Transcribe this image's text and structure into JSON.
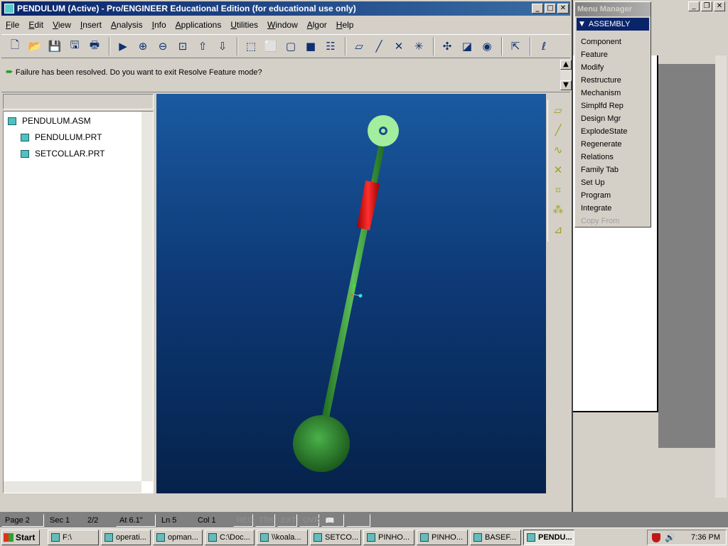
{
  "window": {
    "title": "PENDULUM (Active) - Pro/ENGINEER Educational Edition (for educational use only)"
  },
  "menubar": [
    "File",
    "Edit",
    "View",
    "Insert",
    "Analysis",
    "Info",
    "Applications",
    "Utilities",
    "Window",
    "Algor",
    "Help"
  ],
  "toolbar_icons": [
    "new-icon",
    "open-icon",
    "save-icon",
    "save-copy-icon",
    "print-icon",
    "sep",
    "repaint-icon",
    "zoom-in-icon",
    "zoom-out-icon",
    "refit-icon",
    "orient-icon",
    "saved-views-icon",
    "sep",
    "wireframe-icon",
    "hidden-line-icon",
    "no-hidden-icon",
    "shading-icon",
    "model-tree-icon",
    "sep",
    "datum-plane-icon",
    "datum-axis-icon",
    "datum-point-icon",
    "csys-icon",
    "sep",
    "spin-center-icon",
    "layer-icon",
    "model-display-icon",
    "sep",
    "context-help-icon",
    "sep",
    "pro-e-logo-icon"
  ],
  "message": {
    "text": "Failure has been resolved. Do you want to exit Resolve Feature mode?"
  },
  "model_tree": {
    "items": [
      {
        "label": "PENDULUM.ASM",
        "level": 0
      },
      {
        "label": "PENDULUM.PRT",
        "level": 1
      },
      {
        "label": "SETCOLLAR.PRT",
        "level": 1
      }
    ]
  },
  "right_toolbar_icons": [
    "datum-plane-icon",
    "datum-axis-icon",
    "datum-curve-icon",
    "datum-point-icon",
    "datum-coord-icon",
    "datum-analysis-icon",
    "datum-csys-icon"
  ],
  "menu_manager": {
    "title": "Menu Manager",
    "header": "ASSEMBLY",
    "items": [
      {
        "label": "Component",
        "enabled": true
      },
      {
        "label": "Feature",
        "enabled": true
      },
      {
        "label": "Modify",
        "enabled": true
      },
      {
        "label": "Restructure",
        "enabled": true
      },
      {
        "label": "Mechanism",
        "enabled": true
      },
      {
        "label": "Simplfd Rep",
        "enabled": true
      },
      {
        "label": "Design Mgr",
        "enabled": true
      },
      {
        "label": "ExplodeState",
        "enabled": true
      },
      {
        "label": "Regenerate",
        "enabled": true
      },
      {
        "label": "Relations",
        "enabled": true
      },
      {
        "label": "Family Tab",
        "enabled": true
      },
      {
        "label": "Set Up",
        "enabled": true
      },
      {
        "label": "Program",
        "enabled": true
      },
      {
        "label": "Integrate",
        "enabled": true
      },
      {
        "label": "Copy From",
        "enabled": false
      }
    ]
  },
  "statusbar": {
    "page": "Page 2",
    "sec": "Sec 1",
    "pages": "2/2",
    "at": "At 6.1\"",
    "ln": "Ln 5",
    "col": "Col 1",
    "rec": "REC",
    "trk": "TRK",
    "ext": "EXT",
    "ovr": "OVR"
  },
  "taskbar": {
    "start": "Start",
    "tasks": [
      {
        "label": "F:\\",
        "active": false
      },
      {
        "label": "operati...",
        "active": false
      },
      {
        "label": "opman...",
        "active": false
      },
      {
        "label": "C:\\Doc...",
        "active": false
      },
      {
        "label": "\\\\koala...",
        "active": false
      },
      {
        "label": "SETCO...",
        "active": false
      },
      {
        "label": "PINHO...",
        "active": false
      },
      {
        "label": "PINHO...",
        "active": false
      },
      {
        "label": "BASEF...",
        "active": false
      },
      {
        "label": "PENDU...",
        "active": true
      }
    ],
    "clock": "7:36 PM"
  },
  "colors": {
    "title_active": "#0a246a",
    "rod": "#3a9a3a",
    "collar": "#e01010",
    "pivot": "#a0f0a0",
    "bob": "#2e8a2e"
  }
}
